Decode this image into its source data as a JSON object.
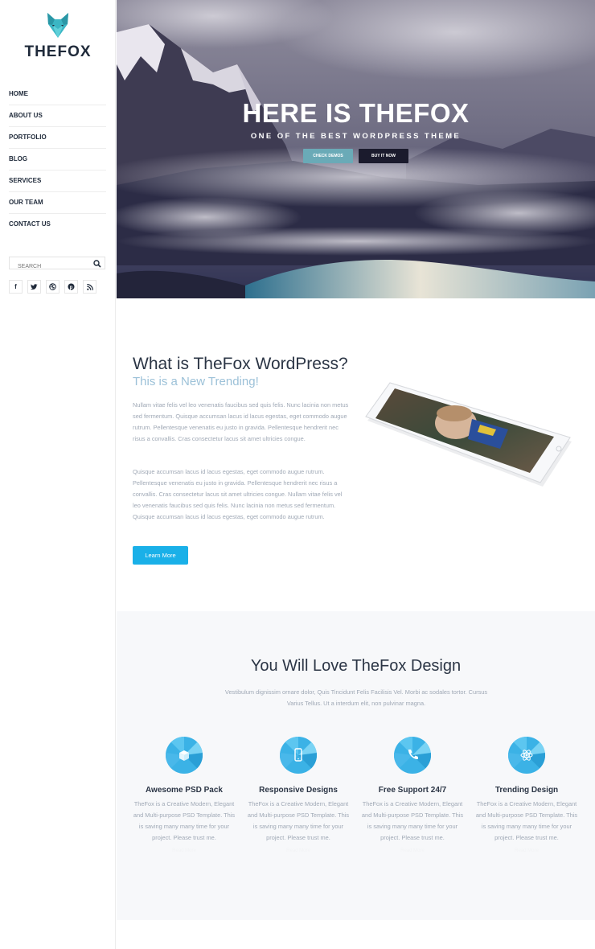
{
  "brand": {
    "name": "THEFOX",
    "accent": "#1ab0e8",
    "logo_color": "#3bb6c4"
  },
  "nav": {
    "items": [
      "HOME",
      "ABOUT US",
      "PORTFOLIO",
      "BLOG",
      "SERVICES",
      "OUR TEAM",
      "CONTACT US"
    ]
  },
  "search": {
    "placeholder": "SEARCH"
  },
  "social": [
    "facebook-icon",
    "twitter-icon",
    "dribbble-icon",
    "pinterest-icon",
    "rss-icon"
  ],
  "hero": {
    "title": "HERE IS THEFOX",
    "subtitle": "ONE OF THE BEST WORDPRESS THEME",
    "btn_demo": "CHECK DEMOS",
    "btn_buy": "BUY IT NOW"
  },
  "about": {
    "title": "What is TheFox WordPress?",
    "subtitle": "This is a New Trending!",
    "para1": "Nullam vitae felis vel leo venenatis faucibus sed quis felis. Nunc lacinia non metus sed fermentum. Quisque accumsan lacus id lacus egestas, eget commodo augue rutrum. Pellentesque venenatis eu justo in gravida. Pellentesque hendrerit nec risus a convallis. Cras consectetur lacus sit amet ultricies congue.",
    "para2": "Quisque accumsan lacus id lacus egestas, eget commodo augue rutrum. Pellentesque venenatis eu justo in gravida. Pellentesque hendrerit nec risus a convallis. Cras consectetur lacus sit amet ultricies congue. Nullam vitae felis vel leo venenatis faucibus sed quis felis. Nunc lacinia non metus sed fermentum. Quisque accumsan lacus id lacus egestas, eget commodo augue rutrum.",
    "button": "Learn More"
  },
  "features": {
    "title": "You Will Love TheFox Design",
    "desc": "Vestibulum dignissim ornare dolor, Quis Tincidunt Felis Facilisis Vel. Morbi ac sodales tortor. Cursus Varius Tellus. Ut a interdum elit, non pulvinar magna.",
    "items": [
      {
        "title": "Awesome PSD Pack",
        "icon": "cube-icon",
        "text": "TheFox is a Creative Modern, Elegant and Multi-purpose PSD Template. This is saving many many time for your project. Please trust me.",
        "link": "Read More"
      },
      {
        "title": "Responsive Designs",
        "icon": "mobile-icon",
        "text": "TheFox is a Creative Modern, Elegant and Multi-purpose PSD Template. This is saving many many time for your project. Please trust me.",
        "link": "Read More"
      },
      {
        "title": "Free Support 24/7",
        "icon": "phone-icon",
        "text": "TheFox is a Creative Modern, Elegant and Multi-purpose PSD Template. This is saving many many time for your project. Please trust me.",
        "link": "Read More"
      },
      {
        "title": "Trending Design",
        "icon": "atom-icon",
        "text": "TheFox is a Creative Modern, Elegant and Multi-purpose PSD Template. This is saving many many time for your project. Please trust me.",
        "link": "Read More"
      }
    ]
  }
}
